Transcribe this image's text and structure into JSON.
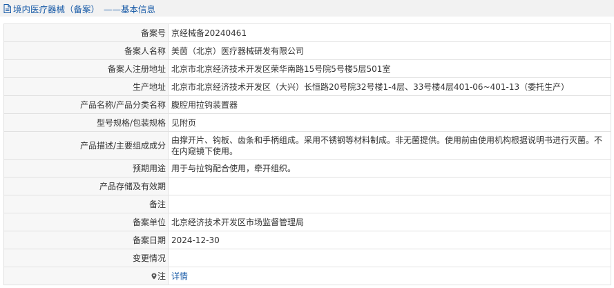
{
  "header": {
    "title": "境内医疗器械（备案）",
    "subtitle": "——基本信息"
  },
  "rows": [
    {
      "label": "备案号",
      "value": "京经械备20240461"
    },
    {
      "label": "备案人名称",
      "value": "美茵（北京）医疗器械研发有限公司"
    },
    {
      "label": "备案人注册地址",
      "value": "北京市北京经济技术开发区荣华南路15号院5号楼5层501室"
    },
    {
      "label": "生产地址",
      "value": "北京市北京经济技术开发区（大兴）长恒路20号院32号楼1-4层、33号楼4层401-06~401-13（委托生产）"
    },
    {
      "label": "产品名称/产品分类名称",
      "value": "腹腔用拉钩装置器"
    },
    {
      "label": "型号规格/包装规格",
      "value": "见附页"
    },
    {
      "label": "产品描述/主要组成成分",
      "value": "由撑开片、钩板、齿条和手柄组成。采用不锈钢等材料制成。非无菌提供。使用前由使用机构根据说明书进行灭菌。不在内窥镜下使用。"
    },
    {
      "label": "预期用途",
      "value": "用于与拉钩配合使用，牵开组织。"
    },
    {
      "label": "产品存储及有效期",
      "value": ""
    },
    {
      "label": "备注",
      "value": ""
    },
    {
      "label": "备案单位",
      "value": "北京经济技术开发区市场监督管理局"
    },
    {
      "label": "备案日期",
      "value": "2024-12-30"
    },
    {
      "label": "变更情况",
      "value": ""
    }
  ],
  "note": {
    "label": "注",
    "link_text": "详情",
    "icon": "map-pin-icon"
  },
  "colors": {
    "accent": "#1a5ca8",
    "label_bg": "#f7f7f7",
    "border": "#e1e1e1"
  }
}
